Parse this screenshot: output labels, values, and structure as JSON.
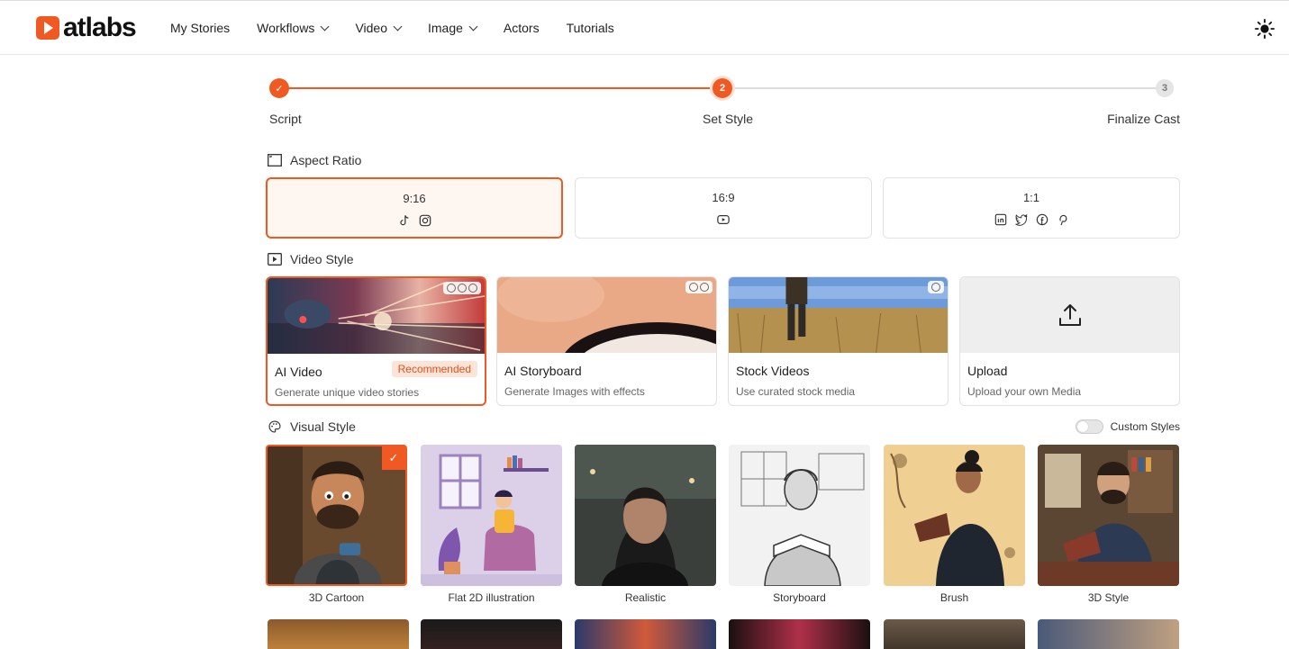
{
  "header": {
    "logo_text": "atlabs",
    "nav": [
      {
        "label": "My Stories",
        "dropdown": false
      },
      {
        "label": "Workflows",
        "dropdown": true
      },
      {
        "label": "Video",
        "dropdown": true
      },
      {
        "label": "Image",
        "dropdown": true
      },
      {
        "label": "Actors",
        "dropdown": false
      },
      {
        "label": "Tutorials",
        "dropdown": false
      }
    ],
    "theme_icon": "sun-icon"
  },
  "stepper": {
    "steps": [
      {
        "label": "Script",
        "status": "done",
        "marker": "✓"
      },
      {
        "label": "Set Style",
        "status": "active",
        "marker": "2"
      },
      {
        "label": "Finalize Cast",
        "status": "todo",
        "marker": "3"
      }
    ]
  },
  "aspect_ratio": {
    "title": "Aspect Ratio",
    "options": [
      {
        "label": "9:16",
        "selected": true,
        "icons": [
          "tiktok-icon",
          "instagram-icon"
        ]
      },
      {
        "label": "16:9",
        "selected": false,
        "icons": [
          "youtube-icon"
        ]
      },
      {
        "label": "1:1",
        "selected": false,
        "icons": [
          "linkedin-icon",
          "twitter-icon",
          "facebook-icon",
          "pinterest-icon"
        ]
      }
    ]
  },
  "video_style": {
    "title": "Video Style",
    "options": [
      {
        "title": "AI Video",
        "subtitle": "Generate unique video stories",
        "badge": "Recommended",
        "credits": 3,
        "selected": true
      },
      {
        "title": "AI Storyboard",
        "subtitle": "Generate Images with effects",
        "badge": "",
        "credits": 2,
        "selected": false
      },
      {
        "title": "Stock Videos",
        "subtitle": "Use curated stock media",
        "badge": "",
        "credits": 1,
        "selected": false
      },
      {
        "title": "Upload",
        "subtitle": "Upload your own Media",
        "badge": "",
        "credits": 0,
        "selected": false
      }
    ]
  },
  "visual_style": {
    "title": "Visual Style",
    "custom_styles_label": "Custom Styles",
    "custom_styles_on": false,
    "options": [
      {
        "label": "3D Cartoon",
        "selected": true
      },
      {
        "label": "Flat 2D illustration",
        "selected": false
      },
      {
        "label": "Realistic",
        "selected": false
      },
      {
        "label": "Storyboard",
        "selected": false
      },
      {
        "label": "Brush",
        "selected": false
      },
      {
        "label": "3D Style",
        "selected": false
      }
    ]
  },
  "colors": {
    "accent": "#f05a22",
    "accent_light": "#fdf6f1"
  }
}
